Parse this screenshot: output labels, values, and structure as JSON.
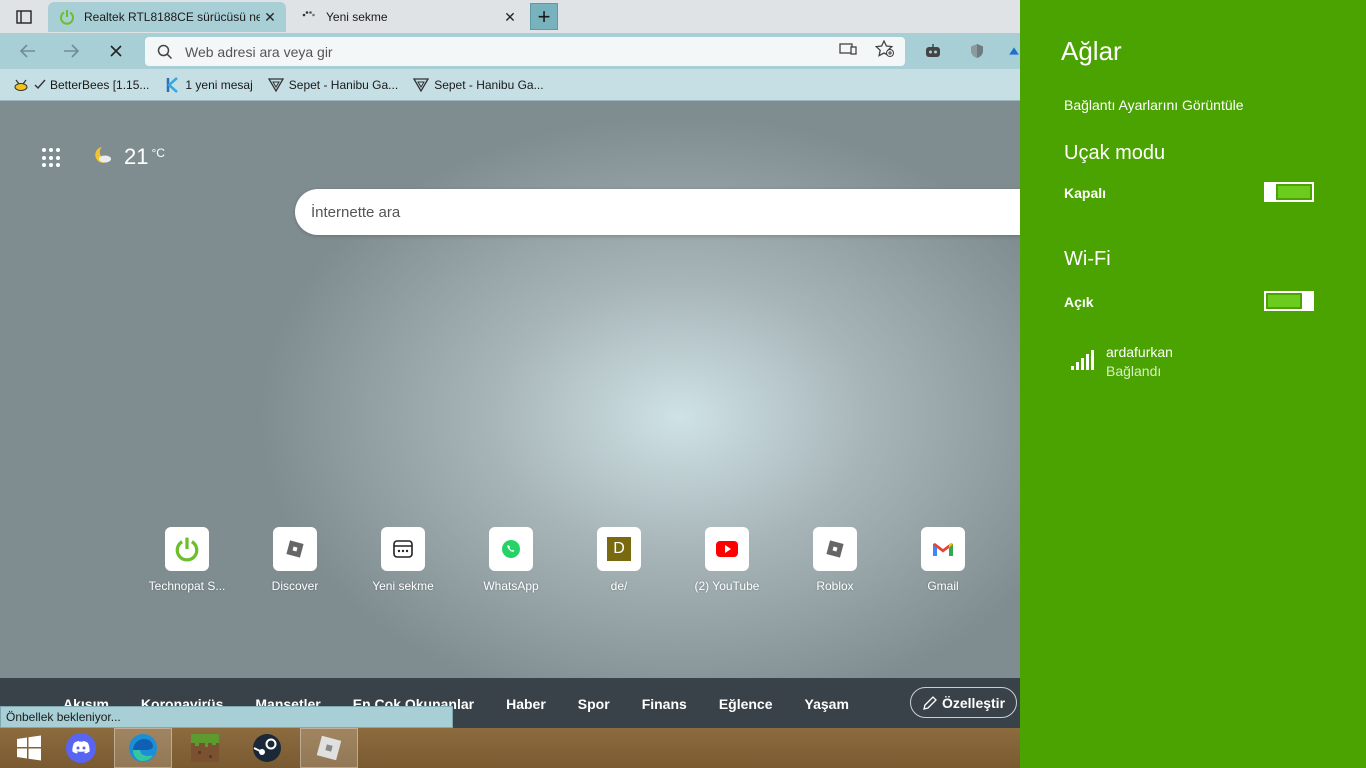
{
  "browser": {
    "tabs": [
      {
        "title": "Realtek RTL8188CE sürücüsü ne",
        "active": true
      },
      {
        "title": "Yeni sekme",
        "active": false
      }
    ],
    "address_placeholder": "Web adresi ara veya gir",
    "favorites": [
      {
        "label": "BetterBees [1.15..."
      },
      {
        "label": "1 yeni mesaj"
      },
      {
        "label": "Sepet - Hanibu Ga..."
      },
      {
        "label": "Sepet - Hanibu Ga..."
      }
    ]
  },
  "ntp": {
    "weather_temp": "21",
    "weather_unit": "°C",
    "search_placeholder": "İnternette ara",
    "tiles": [
      {
        "label": "Technopat S..."
      },
      {
        "label": "Discover"
      },
      {
        "label": "Yeni sekme"
      },
      {
        "label": "WhatsApp"
      },
      {
        "label": "de/",
        "letter": "D"
      },
      {
        "label": "(2) YouTube"
      },
      {
        "label": "Roblox"
      },
      {
        "label": "Gmail"
      }
    ],
    "news_tabs": [
      "Akışım",
      "Koronavirüs",
      "Manşetler",
      "En Çok Okunanlar",
      "Haber",
      "Spor",
      "Finans",
      "Eğlence",
      "Yaşam"
    ],
    "customize_label": "Özelleştir",
    "status_text": "Önbellek bekleniyor..."
  },
  "networks": {
    "title": "Ağlar",
    "view_settings": "Bağlantı Ayarlarını Görüntüle",
    "airplane": {
      "heading": "Uçak modu",
      "state": "Kapalı",
      "on": false
    },
    "wifi": {
      "heading": "Wi-Fi",
      "state": "Açık",
      "on": true
    },
    "connection": {
      "name": "ardafurkan",
      "status": "Bağlandı"
    }
  },
  "colors": {
    "charm_bg": "#4aa300",
    "toggle_fill": "#6ccc1e",
    "chrome_accent": "#a9cfd6"
  }
}
